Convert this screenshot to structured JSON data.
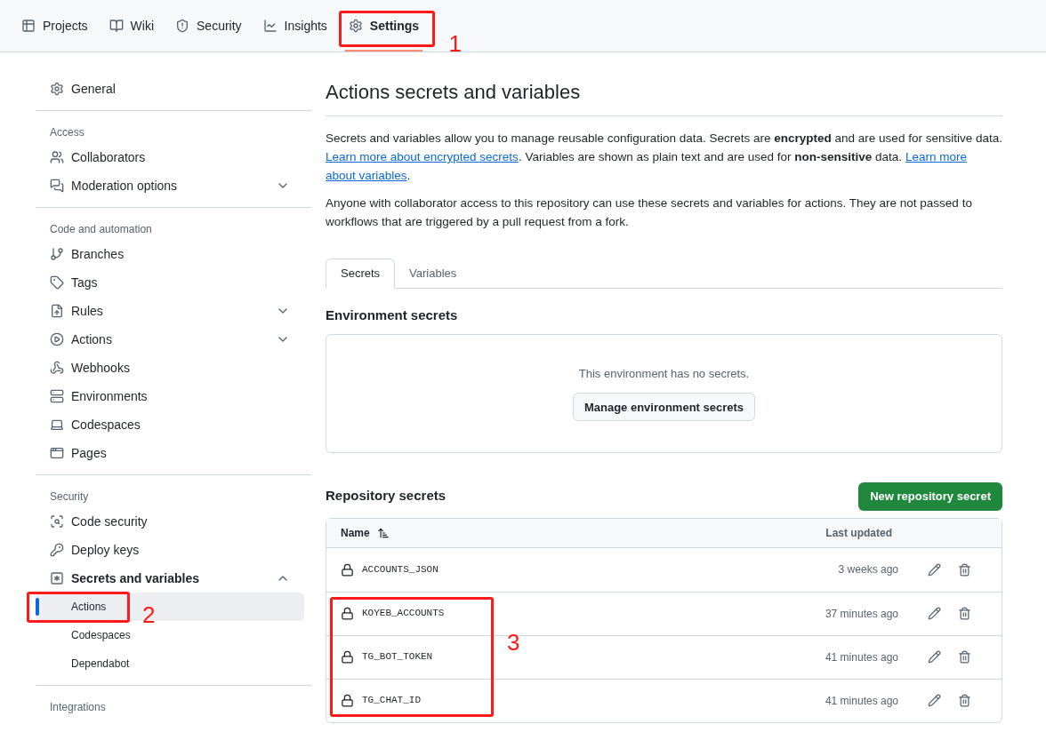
{
  "nav": {
    "tabs": [
      {
        "label": "Projects",
        "selected": false
      },
      {
        "label": "Wiki",
        "selected": false
      },
      {
        "label": "Security",
        "selected": false
      },
      {
        "label": "Insights",
        "selected": false
      },
      {
        "label": "Settings",
        "selected": true,
        "callout": "1"
      }
    ]
  },
  "sidebar": {
    "sections": [
      {
        "items": [
          {
            "label": "General"
          }
        ]
      },
      {
        "heading": "Access",
        "items": [
          {
            "label": "Collaborators"
          },
          {
            "label": "Moderation options",
            "expanded": false
          }
        ]
      },
      {
        "heading": "Code and automation",
        "items": [
          {
            "label": "Branches"
          },
          {
            "label": "Tags"
          },
          {
            "label": "Rules",
            "expanded": false
          },
          {
            "label": "Actions",
            "expanded": false
          },
          {
            "label": "Webhooks"
          },
          {
            "label": "Environments"
          },
          {
            "label": "Codespaces"
          },
          {
            "label": "Pages"
          }
        ]
      },
      {
        "heading": "Security",
        "items": [
          {
            "label": "Code security"
          },
          {
            "label": "Deploy keys"
          },
          {
            "label": "Secrets and variables",
            "expanded": true,
            "children": [
              {
                "label": "Actions",
                "selected": true,
                "callout": "2"
              },
              {
                "label": "Codespaces",
                "selected": false
              },
              {
                "label": "Dependabot",
                "selected": false
              }
            ]
          }
        ]
      },
      {
        "heading": "Integrations"
      }
    ]
  },
  "main": {
    "title": "Actions secrets and variables",
    "intro": "Secrets and variables allow you to manage reusable configuration data. Secrets are **encrypted** and are used for sensitive data.",
    "intro_link": "Learn more about encrypted secrets",
    "intro_2": ". Variables are shown as plain text and are used for **non-sensitive** data.",
    "intro_link_2a": "Learn more",
    "intro_link_2b": "about variables",
    "intro_end": ".",
    "note": "Anyone with collaborator access to this repository can use these secrets and variables for actions. They are not passed to workflows that are triggered by a pull request from a fork.",
    "tabs": [
      {
        "label": "Secrets",
        "selected": true
      },
      {
        "label": "Variables",
        "selected": false
      }
    ],
    "environment": {
      "heading": "Environment secrets",
      "empty_text": "This environment has no secrets.",
      "button": "Manage environment secrets"
    },
    "repository": {
      "heading": "Repository secrets",
      "new_button": "New repository secret",
      "table": {
        "columns": [
          "Name",
          "Last updated"
        ],
        "callout": "3",
        "rows": [
          {
            "name": "ACCOUNTS_JSON",
            "updated": "3 weeks ago",
            "in_callout": false
          },
          {
            "name": "KOYEB_ACCOUNTS",
            "updated": "37 minutes ago",
            "in_callout": true
          },
          {
            "name": "TG_BOT_TOKEN",
            "updated": "41 minutes ago",
            "in_callout": true
          },
          {
            "name": "TG_CHAT_ID",
            "updated": "41 minutes ago",
            "in_callout": true
          }
        ]
      }
    }
  }
}
